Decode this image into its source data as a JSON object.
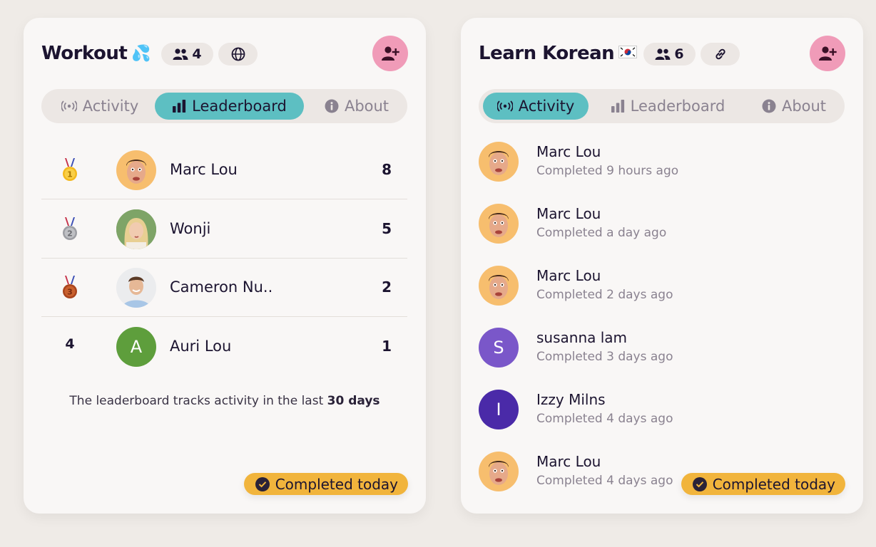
{
  "workout": {
    "title": "Workout",
    "title_emoji": "💦",
    "member_count": "4",
    "tabs": [
      {
        "label": "Activity",
        "active": false
      },
      {
        "label": "Leaderboard",
        "active": true
      },
      {
        "label": "About",
        "active": false
      }
    ],
    "leaderboard": [
      {
        "rank": "1",
        "medal": "gold-medal",
        "name": "Marc Lou",
        "score": "8"
      },
      {
        "rank": "2",
        "medal": "silver-medal",
        "name": "Wonji",
        "score": "5"
      },
      {
        "rank": "3",
        "medal": "bronze-medal",
        "name": "Cameron Nu..",
        "score": "2"
      },
      {
        "rank": "4",
        "medal": "",
        "name": "Auri Lou",
        "initial": "A",
        "score": "1"
      }
    ],
    "note_prefix": "The leaderboard tracks activity in the last",
    "note_bold": "30 days",
    "completed_badge": "Completed today"
  },
  "korean": {
    "title": "Learn Korean",
    "title_emoji": "🇰🇷",
    "member_count": "6",
    "tabs": [
      {
        "label": "Activity",
        "active": true
      },
      {
        "label": "Leaderboard",
        "active": false
      },
      {
        "label": "About",
        "active": false
      }
    ],
    "activity": [
      {
        "name": "Marc Lou",
        "time": "Completed 9 hours ago"
      },
      {
        "name": "Marc Lou",
        "time": "Completed a day ago"
      },
      {
        "name": "Marc Lou",
        "time": "Completed 2 days ago"
      },
      {
        "name": "susanna lam",
        "initial": "S",
        "time": "Completed 3 days ago"
      },
      {
        "name": "Izzy Milns",
        "initial": "I",
        "time": "Completed 4 days ago"
      },
      {
        "name": "Marc Lou",
        "time": "Completed 4 days ago"
      }
    ],
    "completed_badge": "Completed today"
  },
  "colors": {
    "accent_tab": "#5dbfc2",
    "add_button": "#f09bb8",
    "completed_badge": "#f1b43c",
    "avatar_green": "#5e9e3c",
    "avatar_purple": "#7a57c9",
    "avatar_indigo": "#4a2aa8"
  },
  "icons": {
    "members": "people-icon",
    "public": "globe-icon",
    "share": "link-icon",
    "add_member": "add-person-icon",
    "activity_tab": "broadcast-icon",
    "leaderboard_tab": "bar-chart-icon",
    "about_tab": "info-icon",
    "completed": "check-circle-icon"
  }
}
